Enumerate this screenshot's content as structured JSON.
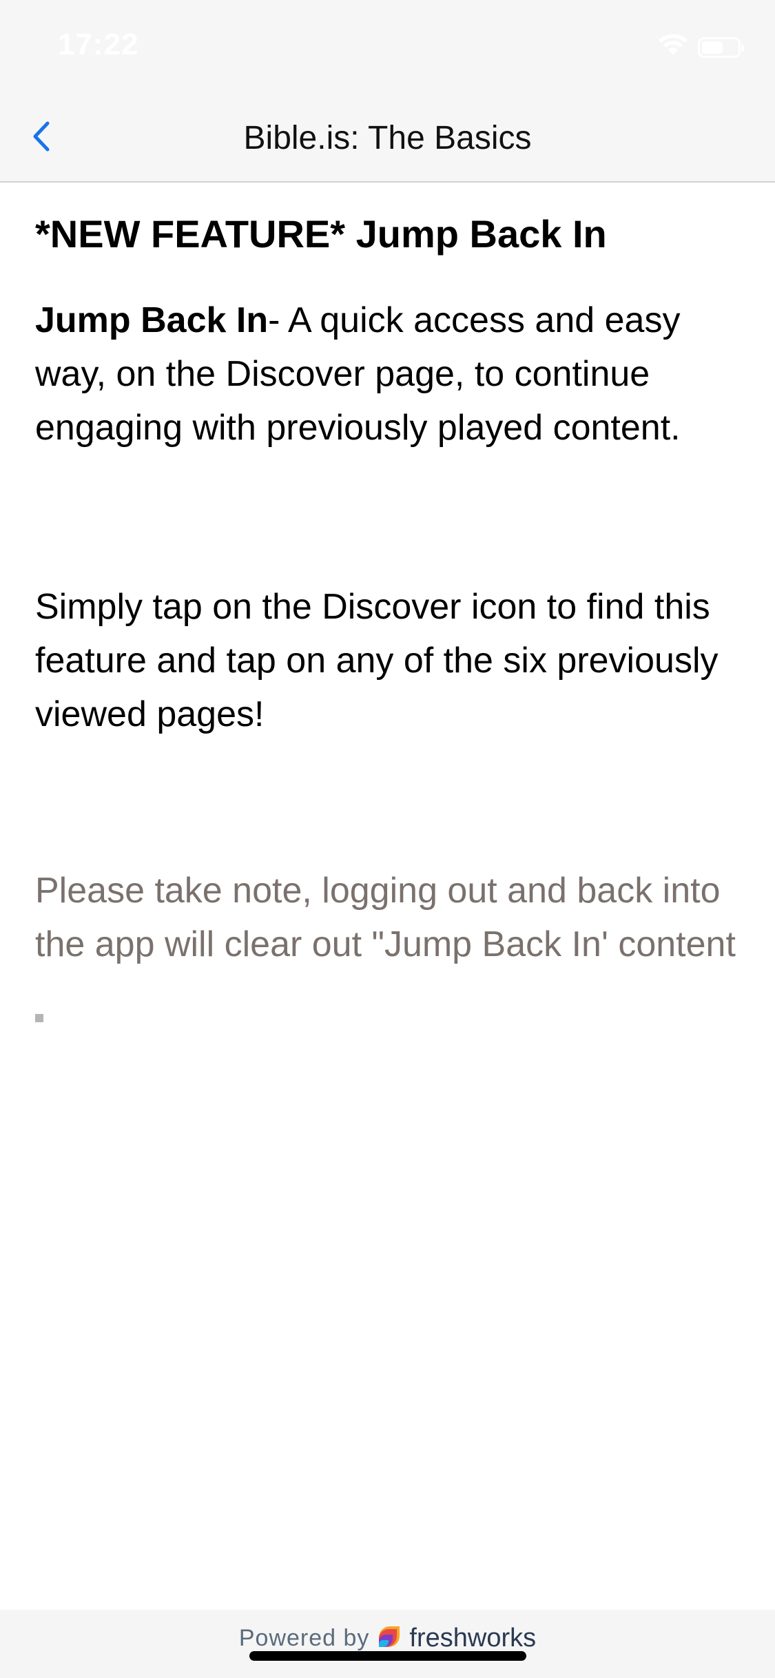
{
  "status_bar": {
    "time": "17:22"
  },
  "nav": {
    "title": "Bible.is: The Basics",
    "back_icon": "chevron-left-icon",
    "accent": "#1a73e8"
  },
  "article": {
    "title": "*NEW FEATURE* Jump Back In",
    "para1_bold": "Jump Back In",
    "para1_rest": "- A quick access and easy way, on the Discover page, to continue engaging with previously played content.",
    "para2": "Simply tap on the Discover icon to find this feature and tap on any of the six previously viewed pages!",
    "note": "Please take note, logging out and back into the app will clear out \"Jump Back In' content",
    "note_color": "#7a716d"
  },
  "footer": {
    "powered_by": "Powered by",
    "brand": "freshworks",
    "brand_icon": "freshworks-logo-icon"
  }
}
